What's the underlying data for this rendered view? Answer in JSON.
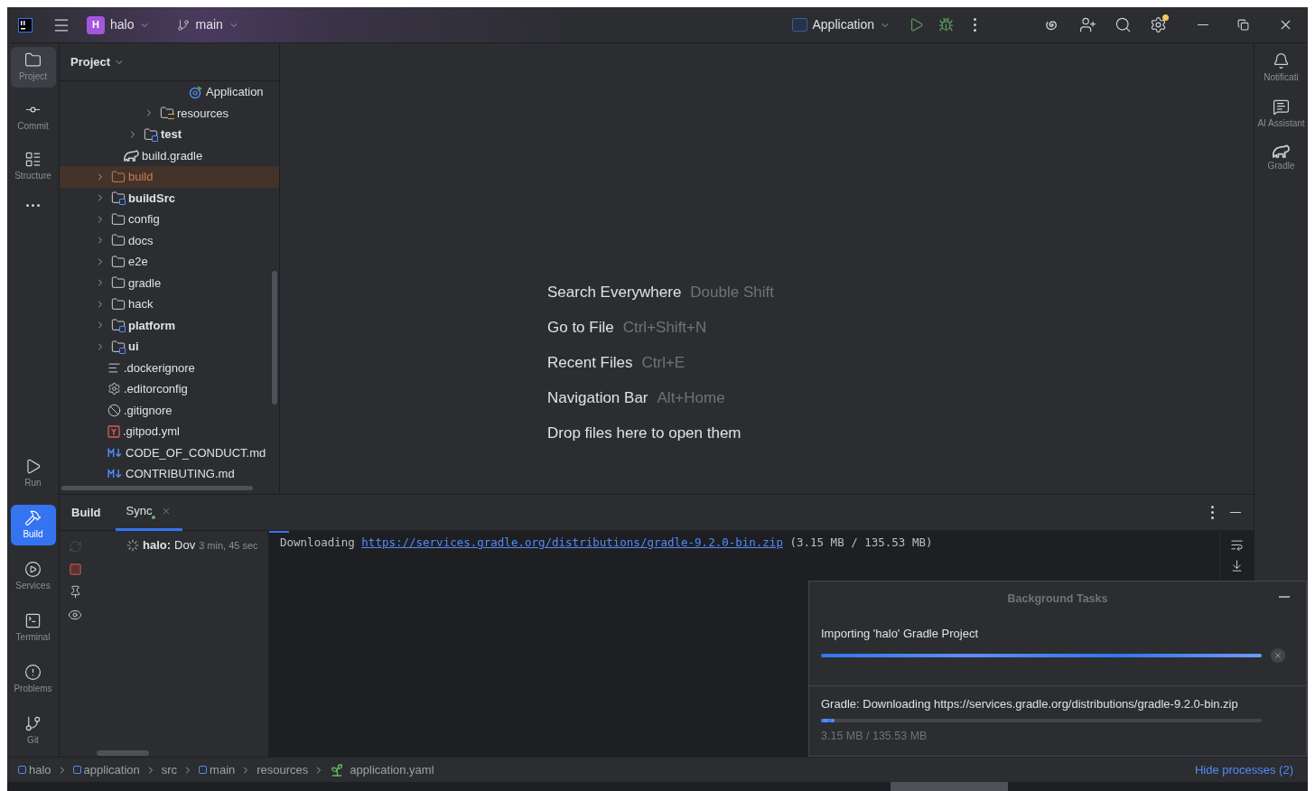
{
  "title_bar": {
    "project_badge": "H",
    "project": "halo",
    "branch": "main",
    "run_config": "Application",
    "settings_notice": true
  },
  "left_stripe": {
    "top": [
      {
        "label": "Project",
        "selected": true,
        "focused": false
      },
      {
        "label": "Commit",
        "selected": false,
        "focused": false
      },
      {
        "label": "Structure",
        "selected": false,
        "focused": false
      },
      {
        "selected": false,
        "focused": false
      }
    ],
    "bottom": [
      {
        "label": "Run",
        "selected": false,
        "focused": false
      },
      {
        "label": "Build",
        "selected": true,
        "focused": true
      },
      {
        "label": "Services",
        "selected": false,
        "focused": false
      },
      {
        "label": "Terminal",
        "selected": false,
        "focused": false
      },
      {
        "label": "Problems",
        "selected": false,
        "focused": false
      },
      {
        "label": "Git",
        "selected": false,
        "focused": false
      }
    ]
  },
  "right_stripe": [
    {
      "label": "Notificati"
    },
    {
      "label": "AI Assistant"
    },
    {
      "label": "Gradle"
    }
  ],
  "project_panel": {
    "title": "Project",
    "tree": [
      {
        "children": [
          {
            "children": [
              {
                "children": [
                  {
                    "children": [
                      {
                        "children": [
                          {
                            "label": "Application",
                            "kind": "app-file",
                            "selected": false
                          }
                        ]
                      }
                    ]
                  },
                  {
                    "label": "resources",
                    "kind": "resources",
                    "expanded": false,
                    "selected": false
                  }
                ]
              },
              {
                "label": "test",
                "kind": "test",
                "expanded": false,
                "selected": false
              }
            ]
          },
          {
            "label": "build.gradle",
            "kind": "gradle-file",
            "selected": false
          }
        ]
      },
      {
        "label": "build",
        "kind": "excluded",
        "expanded": false,
        "selected": true
      },
      {
        "label": "buildSrc",
        "kind": "module",
        "expanded": false,
        "selected": false
      },
      {
        "label": "config",
        "kind": "folder",
        "expanded": false,
        "selected": false
      },
      {
        "label": "docs",
        "kind": "folder",
        "expanded": false,
        "selected": false
      },
      {
        "label": "e2e",
        "kind": "folder",
        "expanded": false,
        "selected": false
      },
      {
        "label": "gradle",
        "kind": "folder",
        "expanded": false,
        "selected": false
      },
      {
        "label": "hack",
        "kind": "folder",
        "expanded": false,
        "selected": false
      },
      {
        "label": "platform",
        "kind": "module",
        "expanded": false,
        "selected": false
      },
      {
        "label": "ui",
        "kind": "module",
        "expanded": false,
        "selected": false
      },
      {
        "label": ".dockerignore",
        "kind": "text-file",
        "selected": false
      },
      {
        "label": ".editorconfig",
        "kind": "config-file",
        "selected": false
      },
      {
        "label": ".gitignore",
        "kind": "ignore-file",
        "selected": false
      },
      {
        "label": ".gitpod.yml",
        "kind": "yaml-file",
        "selected": false
      },
      {
        "label": "CODE_OF_CONDUCT.md",
        "kind": "markdown-file",
        "selected": false
      },
      {
        "label": "CONTRIBUTING.md",
        "kind": "markdown-file",
        "selected": false
      }
    ]
  },
  "editor_hints": [
    {
      "action": "Search Everywhere",
      "shortcut": "Double Shift"
    },
    {
      "action": "Go to File",
      "shortcut": "Ctrl+Shift+N"
    },
    {
      "action": "Recent Files",
      "shortcut": "Ctrl+E"
    },
    {
      "action": "Navigation Bar",
      "shortcut": "Alt+Home"
    },
    {
      "action": "Drop files here to open them"
    }
  ],
  "build_window": {
    "title": "Build",
    "tabs": [
      {
        "label": "Sync",
        "selected": true,
        "running": true
      }
    ],
    "task": {
      "name": "halo:",
      "status": "Dov",
      "elapsed": "3 min, 45 sec"
    },
    "console": {
      "prefix": "Downloading",
      "link": "https://services.gradle.org/distributions/gradle-9.2.0-bin.zip",
      "suffix": "(3.15 MB / 135.53 MB)"
    }
  },
  "background_tasks": {
    "title": "Background Tasks",
    "tasks": [
      {
        "label": "Importing 'halo' Gradle Project",
        "level": 1,
        "cancellable": true
      },
      {
        "label": "Gradle: Downloading https://services.gradle.org/distributions/gradle-9.2.0-bin.zip",
        "level": 0.03,
        "cancellable": false,
        "detail": "3.15 MB / 135.53 MB"
      }
    ]
  },
  "breadcrumbs": [
    {
      "label": "halo",
      "kind": "module"
    },
    {
      "label": "application",
      "kind": "module"
    },
    {
      "label": "src",
      "kind": "folder"
    },
    {
      "label": "main",
      "kind": "module"
    },
    {
      "label": "resources",
      "kind": "folder"
    },
    {
      "label": "application.yaml",
      "kind": "yaml"
    }
  ],
  "status_bar": {
    "link": "Hide processes (2)"
  }
}
